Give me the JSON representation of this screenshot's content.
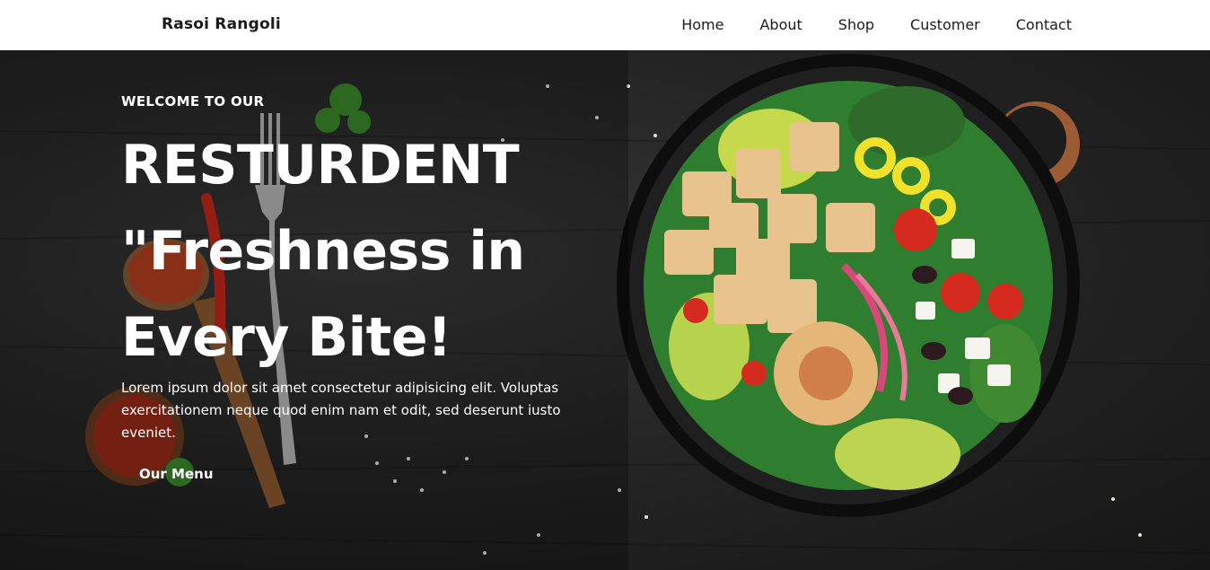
{
  "header": {
    "brand": "Rasoi Rangoli",
    "nav": [
      {
        "label": "Home"
      },
      {
        "label": "About"
      },
      {
        "label": "Shop"
      },
      {
        "label": "Customer"
      },
      {
        "label": "Contact"
      }
    ]
  },
  "hero": {
    "eyebrow": "WELCOME TO OUR",
    "headline_line1": "RESTURDENT",
    "headline_line2": "\"Freshness in",
    "headline_line3": "Every Bite!",
    "paragraph": "Lorem ipsum dolor sit amet consectetur adipisicing elit. Voluptas exercitationem neque quod enim nam et odit, sed deserunt iusto eveniet.",
    "cta_label": "Our Menu"
  },
  "colors": {
    "header_bg": "#ffffff",
    "hero_bg": "#262626",
    "text_light": "#ffffff"
  }
}
